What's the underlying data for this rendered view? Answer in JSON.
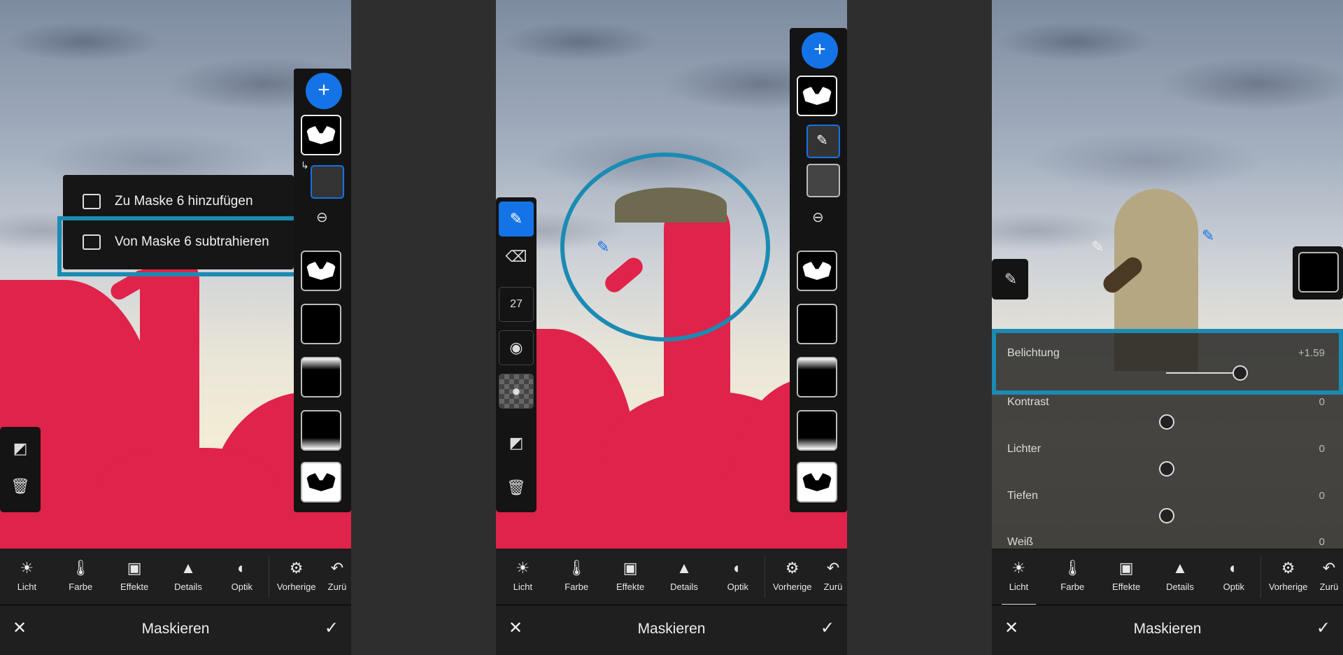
{
  "menu": {
    "add_label": "Zu Maske 6 hinzufügen",
    "subtract_label": "Von Maske 6 subtrahieren"
  },
  "tabs": [
    {
      "label": "Licht",
      "icon": "sun-icon"
    },
    {
      "label": "Farbe",
      "icon": "thermometer-icon"
    },
    {
      "label": "Effekte",
      "icon": "vignette-icon"
    },
    {
      "label": "Details",
      "icon": "triangle-icon"
    },
    {
      "label": "Optik",
      "icon": "lens-icon"
    }
  ],
  "tab_previous": "Vorherige",
  "tab_reset_partial": "Zurü",
  "bottom": {
    "title": "Maskieren"
  },
  "brush": {
    "size": "27"
  },
  "sliders": [
    {
      "label": "Belichtung",
      "value": "+1.59",
      "position": 0.73
    },
    {
      "label": "Kontrast",
      "value": "0",
      "position": 0.5
    },
    {
      "label": "Lichter",
      "value": "0",
      "position": 0.5
    },
    {
      "label": "Tiefen",
      "value": "0",
      "position": 0.5
    },
    {
      "label": "Weiß",
      "value": "0",
      "position": 0.5
    }
  ],
  "colors": {
    "accent": "#1473e6",
    "highlight": "#1b8bb3",
    "mask_red": "#e0234a"
  }
}
